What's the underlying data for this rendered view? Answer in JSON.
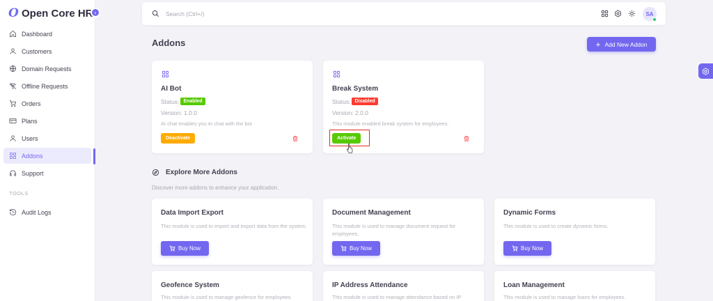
{
  "brand": {
    "name": "Open Core HR",
    "logo_letter": "O"
  },
  "sidebar": {
    "items": [
      {
        "label": "Dashboard",
        "icon": "home-icon"
      },
      {
        "label": "Customers",
        "icon": "user-icon"
      },
      {
        "label": "Domain Requests",
        "icon": "globe-icon"
      },
      {
        "label": "Offline Requests",
        "icon": "wifi-off-icon"
      },
      {
        "label": "Orders",
        "icon": "cart-icon"
      },
      {
        "label": "Plans",
        "icon": "credit-card-icon"
      },
      {
        "label": "Users",
        "icon": "user-icon"
      },
      {
        "label": "Addons",
        "icon": "grid-icon",
        "active": true
      },
      {
        "label": "Support",
        "icon": "headset-icon"
      }
    ],
    "section_label": "TOOLS",
    "tools_items": [
      {
        "label": "Audit Logs",
        "icon": "history-icon"
      }
    ]
  },
  "topbar": {
    "search_placeholder": "Search (Ctrl+/)",
    "avatar_initials": "SA"
  },
  "page": {
    "title": "Addons",
    "add_button_label": "Add New Addon"
  },
  "installed_addons": [
    {
      "title": "AI Bot",
      "status_label": "Status:",
      "status": "Enabled",
      "version_label": "Version:",
      "version": "1.0.0",
      "description": "AI chat enables you to chat with the bot",
      "action_label": "Deactivate"
    },
    {
      "title": "Break System",
      "status_label": "Status:",
      "status": "Disabled",
      "version_label": "Version:",
      "version": "2.0.0",
      "description": "This module enabled break system for employees.",
      "action_label": "Activate"
    }
  ],
  "explore": {
    "title": "Explore More Addons",
    "subtitle": "Discover more addons to enhance your application.",
    "buy_label": "Buy Now",
    "addons": [
      {
        "title": "Data Import Export",
        "description": "This module is used to import and export data from the system."
      },
      {
        "title": "Document Management",
        "description": "This module is used to manage document request for employees."
      },
      {
        "title": "Dynamic Forms",
        "description": "This module is used to create dynamic forms."
      },
      {
        "title": "Geofence System",
        "description": "This module is used to manage geofence for employees."
      },
      {
        "title": "IP Address Attendance",
        "description": "This module is used to manage attendance based on IP"
      },
      {
        "title": "Loan Management",
        "description": "This module is used to manage loans for employees."
      }
    ]
  },
  "colors": {
    "primary": "#7367f0",
    "enabled": "#56ca00",
    "disabled": "#ff3b30",
    "warning": "#ffab00",
    "highlight": "#e0291f"
  }
}
